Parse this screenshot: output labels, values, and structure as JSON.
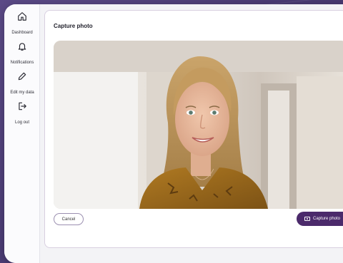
{
  "sidebar": {
    "items": [
      {
        "label": "Dashboard",
        "icon": "home-icon"
      },
      {
        "label": "Notifications",
        "icon": "bell-icon"
      },
      {
        "label": "Edit my data",
        "icon": "pencil-icon"
      },
      {
        "label": "Log out",
        "icon": "logout-icon"
      }
    ]
  },
  "card": {
    "title": "Capture photo",
    "cancel_label": "Cancel",
    "capture_label": "Capture photo"
  },
  "colors": {
    "accent": "#4b2a6b",
    "background": "#4a3b73",
    "card_border": "#d8cfe0"
  }
}
